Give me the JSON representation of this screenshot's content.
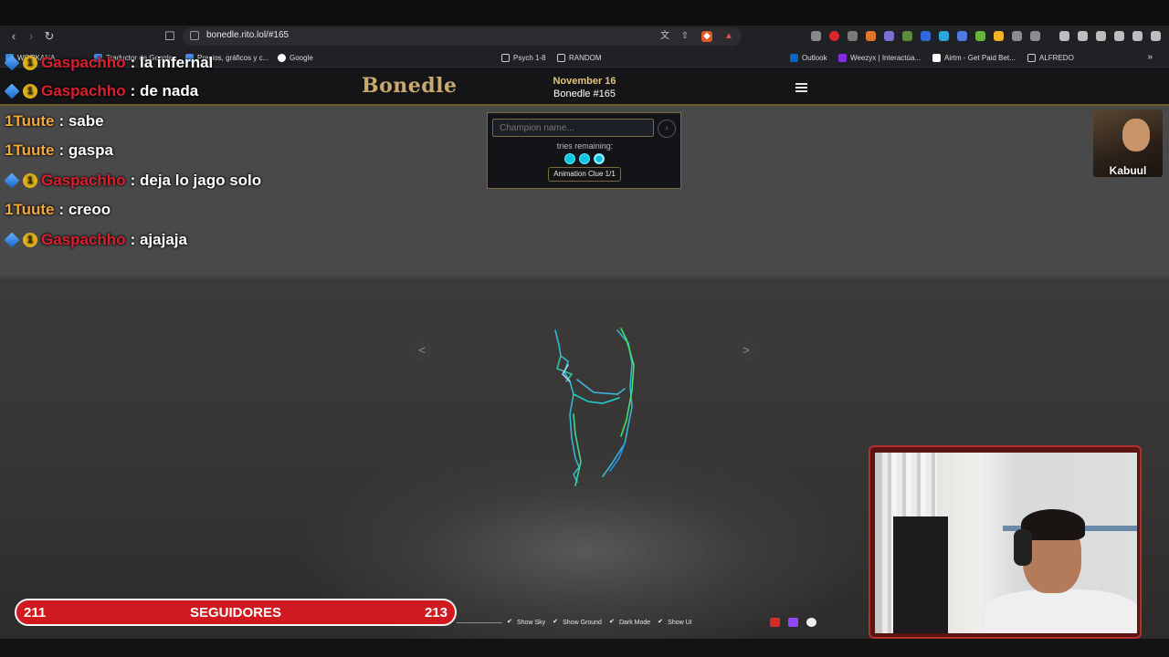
{
  "browser": {
    "url": "bonedle.rito.lol/#165",
    "bookmarks": [
      {
        "label": "WORKANA"
      },
      {
        "label": "Traductor de Google"
      },
      {
        "label": "Precios, gráficos y c..."
      },
      {
        "label": "Google"
      },
      {
        "label": "Psych 1-8"
      },
      {
        "label": "RANDOM"
      },
      {
        "label": "Outlook"
      },
      {
        "label": "Weezyx | Interactúa..."
      },
      {
        "label": "Airtm - Get Paid Bet..."
      },
      {
        "label": "ALFREDO"
      }
    ],
    "more_label": "»"
  },
  "site": {
    "logo": "Bonedle",
    "date": "November 16",
    "puzzle_number": "Bonedle #165"
  },
  "guess": {
    "placeholder": "Champion name...",
    "submit_label": "›",
    "tries_label": "tries remaining:",
    "tries_remaining": 3,
    "clue_label": "Animation Clue 1/1"
  },
  "viewer": {
    "prev_label": "<",
    "next_label": ">",
    "options": [
      {
        "label": "Show Sky",
        "checked": true
      },
      {
        "label": "Show Ground",
        "checked": true
      },
      {
        "label": "Dark Mode",
        "checked": true
      },
      {
        "label": "Show UI",
        "checked": true
      }
    ]
  },
  "chat": {
    "lines": [
      {
        "user": "Gaspachho",
        "message": ": la infernal",
        "badges": true,
        "color": "red"
      },
      {
        "user": "Gaspachho",
        "message": ": de nada",
        "badges": true,
        "color": "red"
      },
      {
        "user": "1Tuute",
        "message": ": sabe",
        "badges": false,
        "color": "orange"
      },
      {
        "user": "1Tuute",
        "message": ": gaspa",
        "badges": false,
        "color": "orange"
      },
      {
        "user": "Gaspachho",
        "message": ": deja lo jago solo",
        "badges": true,
        "color": "red"
      },
      {
        "user": "1Tuute",
        "message": ": creoo",
        "badges": false,
        "color": "orange"
      },
      {
        "user": "Gaspachho",
        "message": ": ajajaja",
        "badges": true,
        "color": "red"
      }
    ]
  },
  "streamer": {
    "name": "Kabuul"
  },
  "followers": {
    "current": "211",
    "label": "SEGUIDORES",
    "goal": "213"
  },
  "colors": {
    "accent_gold": "#c8aa6e",
    "tries_cyan": "#0bc6e3",
    "follower_red": "#d01a1f"
  }
}
